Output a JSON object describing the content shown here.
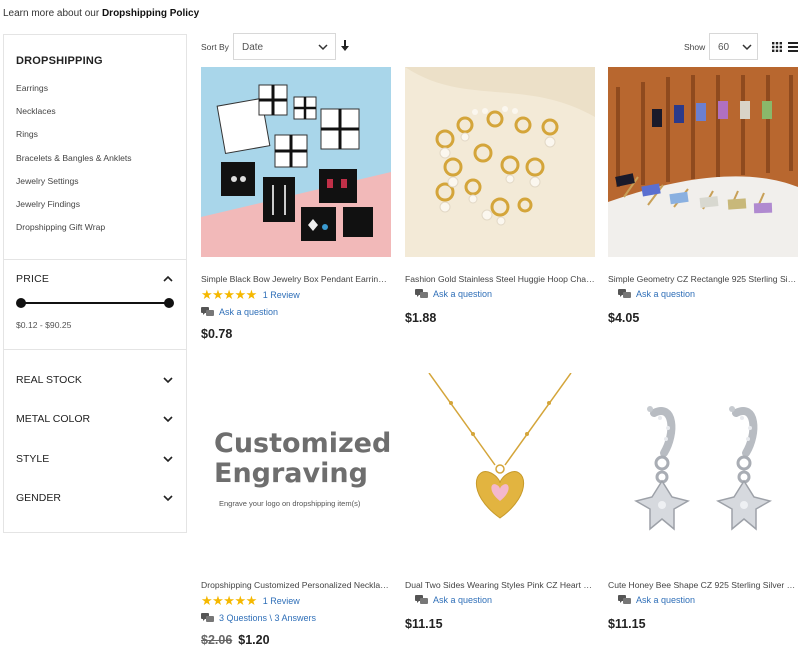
{
  "notice": {
    "prefix": "Learn more about our ",
    "link": "Dropshipping Policy"
  },
  "sidebar": {
    "category_title": "DROPSHIPPING",
    "categories": [
      "Earrings",
      "Necklaces",
      "Rings",
      "Bracelets & Bangles & Anklets",
      "Jewelry Settings",
      "Jewelry Findings",
      "Dropshipping Gift Wrap"
    ],
    "price": {
      "title": "PRICE",
      "range": "$0.12 - $90.25",
      "min_fraction": 0,
      "max_fraction": 1
    },
    "filters": [
      "REAL STOCK",
      "METAL COLOR",
      "STYLE",
      "GENDER"
    ]
  },
  "toolbar": {
    "sort_label": "Sort By",
    "sort_value": "Date",
    "show_label": "Show",
    "show_value": "60"
  },
  "products": [
    {
      "title": "Simple Black Bow Jewelry Box Pendant Earring Ring J...",
      "stars": "★★★★★",
      "review": "1 Review",
      "ask": "Ask a question",
      "price": "$0.78"
    },
    {
      "title": "Fashion Gold Stainless Steel Huggie Hoop Charm Pen...",
      "ask": "Ask a question",
      "price": "$1.88"
    },
    {
      "title": "Simple Geometry CZ Rectangle 925 Sterling Silver St...",
      "ask": "Ask a question",
      "price": "$4.05"
    },
    {
      "title": "Dropshipping Customized Personalized Necklaces Eng...",
      "stars": "★★★★★",
      "review": "1 Review",
      "ask": "3 Questions \\ 3 Answers",
      "old_price": "$2.06",
      "price": "$1.20",
      "image_title_1": "Customized",
      "image_title_2": "Engraving",
      "image_caption": "Engrave your logo on dropshipping item(s)"
    },
    {
      "title": "Dual Two Sides Wearing Styles Pink CZ Heart 925 St...",
      "ask": "Ask a question",
      "price": "$11.15"
    },
    {
      "title": "Cute Honey Bee Shape CZ 925 Sterling Silver Danglin...",
      "ask": "Ask a question",
      "price": "$11.15"
    }
  ],
  "colors": {
    "link": "#2f6fb8",
    "star": "#f5b800"
  }
}
